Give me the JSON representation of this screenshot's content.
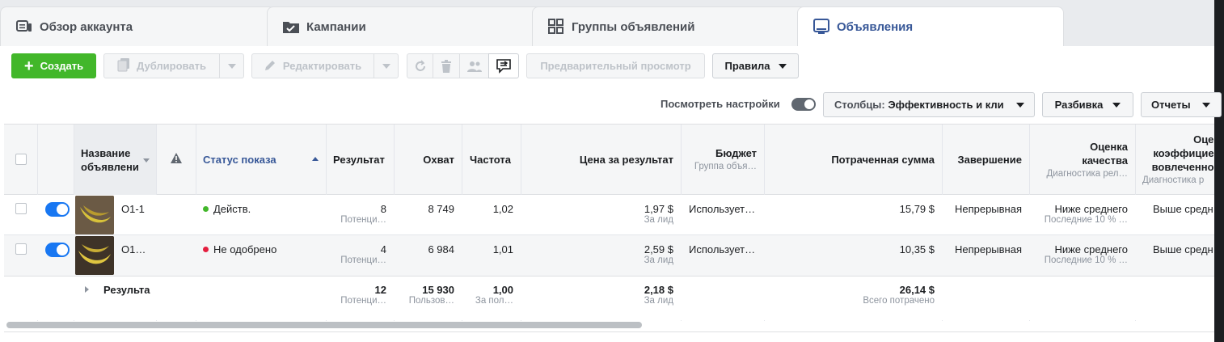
{
  "tabs": [
    {
      "label": "Обзор аккаунта",
      "icon": "account-overview-icon"
    },
    {
      "label": "Кампании",
      "icon": "folder-check-icon"
    },
    {
      "label": "Группы объявлений",
      "icon": "grid-icon"
    },
    {
      "label": "Объявления",
      "icon": "ad-icon"
    }
  ],
  "toolbar": {
    "create": "Создать",
    "duplicate": "Дублировать",
    "edit": "Редактировать",
    "preview": "Предварительный просмотр",
    "rules": "Правила"
  },
  "settings": {
    "view_settings": "Посмотреть настройки",
    "columns_prefix": "Столбцы: ",
    "columns_value": "Эффективность и кли",
    "breakdown": "Разбивка",
    "reports": "Отчеты"
  },
  "headers": {
    "name": "Название объявлени",
    "status": "Статус показа",
    "results": "Результат",
    "reach": "Охват",
    "frequency": "Частота",
    "cost_per_result": "Цена за результат",
    "budget": "Бюджет",
    "budget_sub": "Группа объя…",
    "spent": "Потраченная сумма",
    "ends": "Завершение",
    "quality": "Оценка качества",
    "quality_sub": "Диагностика рел…",
    "engagement": "Оценка коэффициента вовлеченности",
    "engagement_sub": "Диагностика р"
  },
  "rows": [
    {
      "name": "O1-1",
      "status": "Действ.",
      "status_color": "#42b72a",
      "results": "8",
      "results_sub": "Потенци…",
      "reach": "8 749",
      "frequency": "1,02",
      "cost": "1,97 $",
      "cost_sub": "За лид",
      "budget": "Использует…",
      "spent": "15,79 $",
      "ends": "Непрерывная",
      "quality": "Ниже среднего",
      "quality_sub": "Последние 10 % …",
      "engagement": "Выше средн"
    },
    {
      "name": "O1…",
      "status": "Не одобрено",
      "status_color": "#e41e3f",
      "results": "4",
      "results_sub": "Потенци…",
      "reach": "6 984",
      "frequency": "1,01",
      "cost": "2,59 $",
      "cost_sub": "За лид",
      "budget": "Использует…",
      "spent": "10,35 $",
      "ends": "Непрерывная",
      "quality": "Ниже среднего",
      "quality_sub": "Последние 10 % …",
      "engagement": "Выше средн"
    }
  ],
  "totals": {
    "label": "Результа",
    "results": "12",
    "results_sub": "Потенци…",
    "reach": "15 930",
    "reach_sub": "Пользов…",
    "frequency": "1,00",
    "frequency_sub": "За пол…",
    "cost": "2,18 $",
    "cost_sub": "За лид",
    "spent": "26,14 $",
    "spent_sub": "Всего потрачено"
  },
  "colors": {
    "accent": "#1877f2",
    "create_button": "#42b72a",
    "active_tab_text": "#385898"
  }
}
